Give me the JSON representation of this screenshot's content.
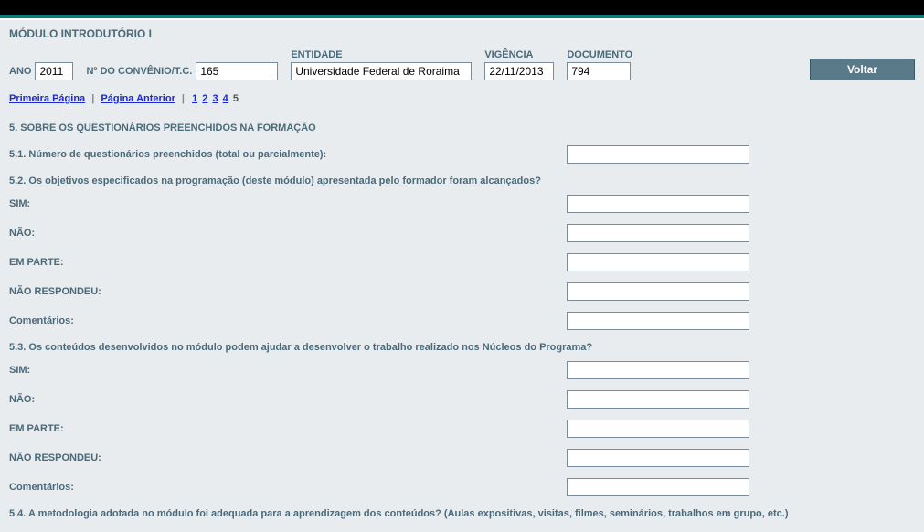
{
  "title": "MÓDULO INTRODUTÓRIO I",
  "header": {
    "ano_label": "ANO",
    "ano_value": "2011",
    "convenio_label": "Nº DO CONVÊNIO/T.C.",
    "convenio_value": "165",
    "entidade_label": "ENTIDADE",
    "entidade_value": "Universidade Federal de Roraima",
    "vigencia_label": "VIGÊNCIA",
    "vigencia_value": "22/11/2013",
    "documento_label": "DOCUMENTO",
    "documento_value": "794",
    "voltar_label": "Voltar"
  },
  "pager": {
    "first": "Primeira Página",
    "prev": "Página Anterior",
    "p1": "1",
    "p2": "2",
    "p3": "3",
    "p4": "4",
    "p5": "5"
  },
  "section5": {
    "heading": "5. SOBRE OS QUESTIONÁRIOS PREENCHIDOS NA FORMAÇÃO",
    "q51_label": "5.1. Número de questionários preenchidos (total ou parcialmente):",
    "q52_label": "5.2. Os objetivos especificados na programação (deste módulo) apresentada pelo formador foram alcançados?",
    "q53_label": "5.3. Os conteúdos desenvolvidos no módulo podem ajudar a desenvolver o trabalho realizado nos Núcleos do Programa?",
    "q54_label": "5.4. A metodologia adotada no módulo foi adequada para a aprendizagem dos conteúdos? (Aulas expositivas, visitas, filmes, seminários, trabalhos em grupo, etc.)",
    "sim": "SIM:",
    "nao": "NÃO:",
    "emparte": "EM PARTE:",
    "naorespondeu": "NÃO RESPONDEU:",
    "comentarios": "Comentários:"
  }
}
